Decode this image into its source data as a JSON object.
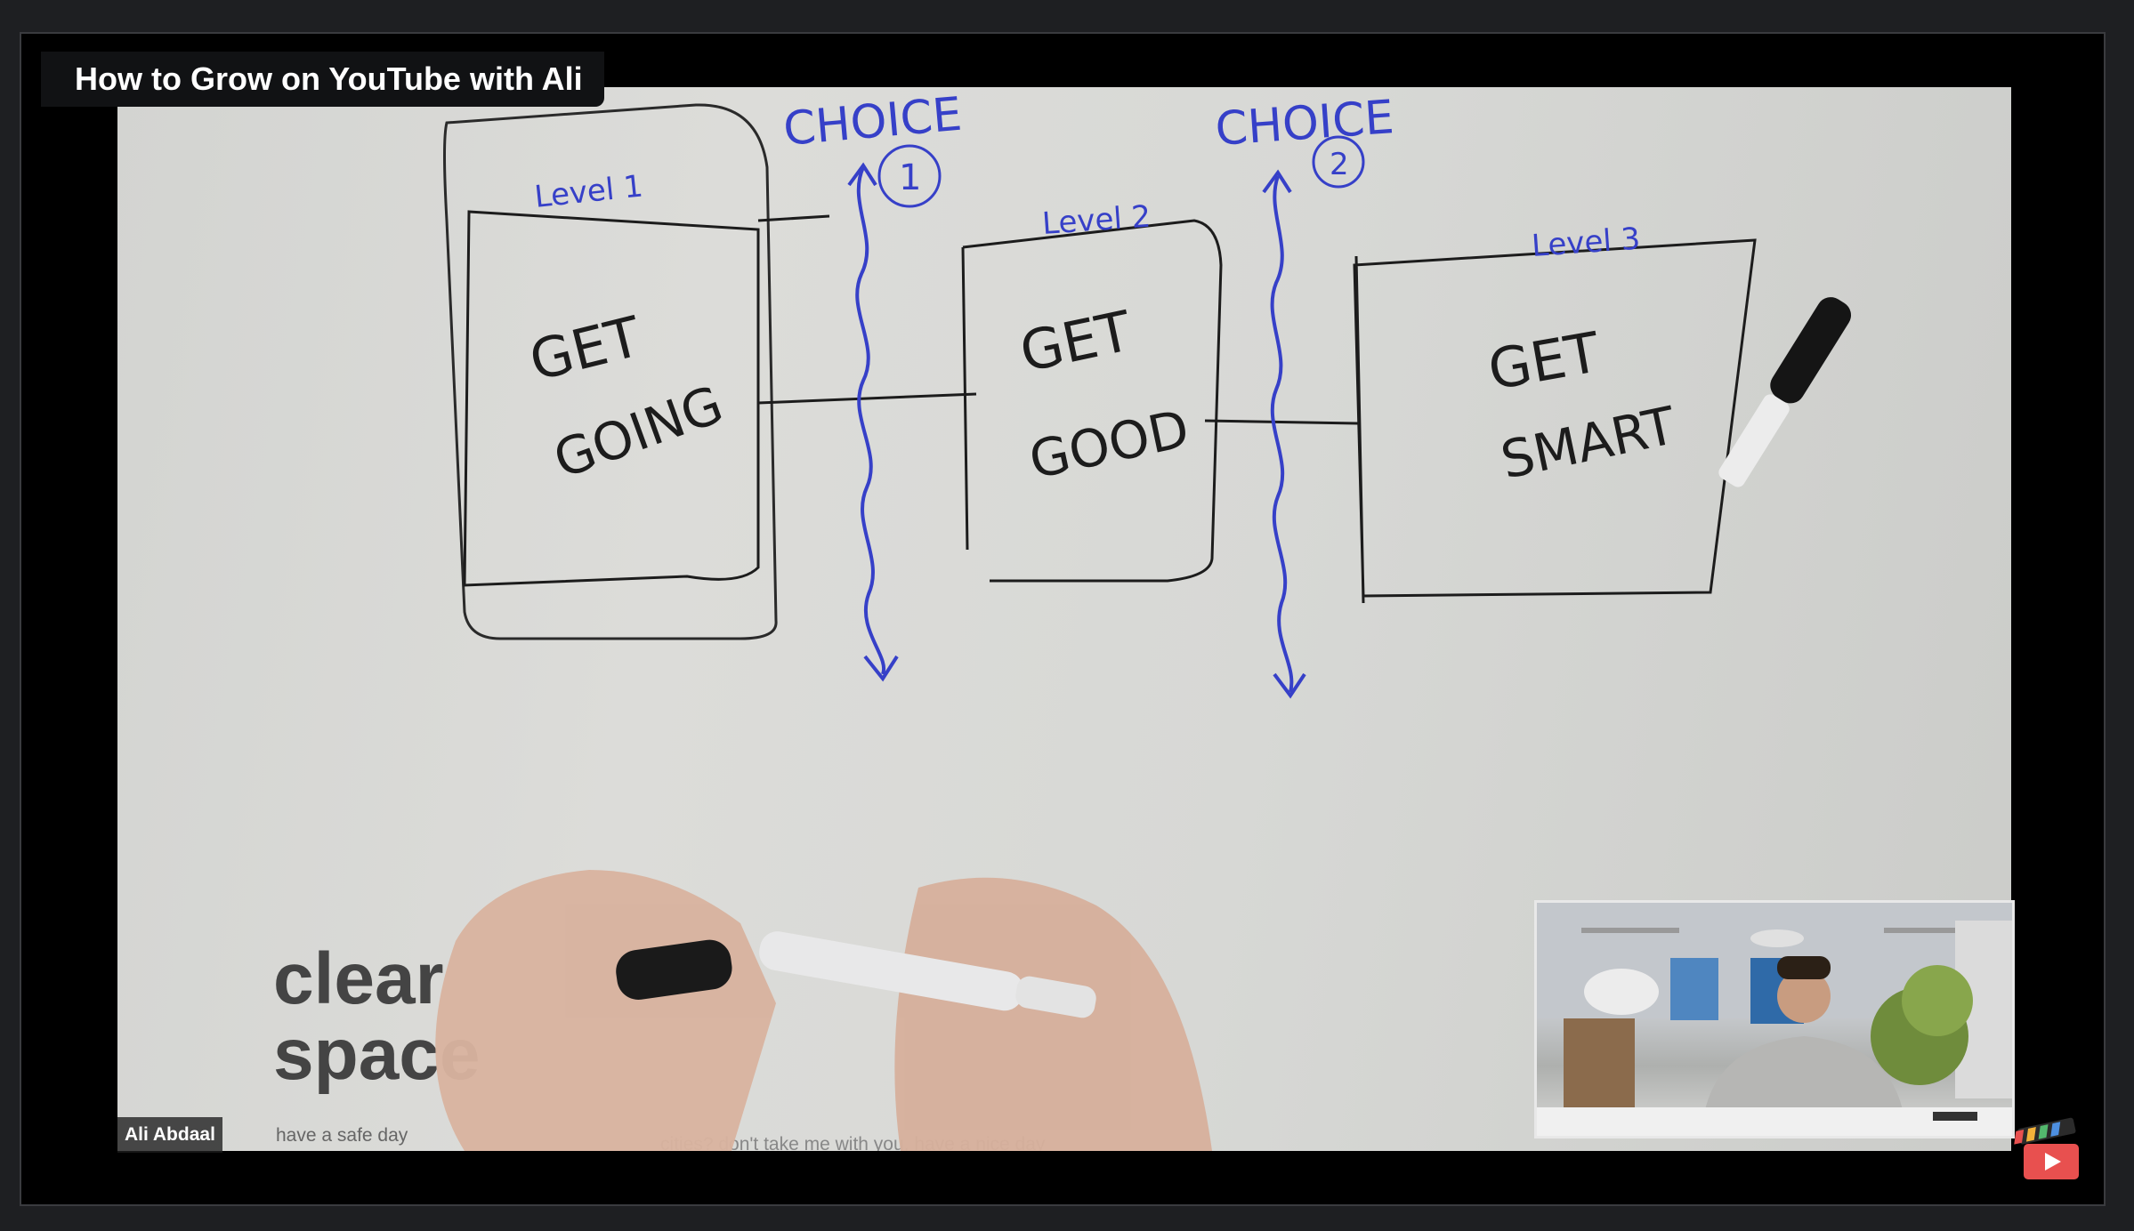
{
  "window": {
    "title": "How to Grow on YouTube with Ali"
  },
  "participant": {
    "name": "Ali Abdaal"
  },
  "whiteboard": {
    "choices": [
      "CHOICE",
      "CHOICE"
    ],
    "choice_numbers": [
      "1",
      "2"
    ],
    "levels": [
      "Level 1",
      "Level 2",
      "Level 3"
    ],
    "boxes": [
      {
        "line1": "GET",
        "line2": "GOING"
      },
      {
        "line1": "GET",
        "line2": "GOOD"
      },
      {
        "line1": "GET",
        "line2": "SMART"
      }
    ],
    "poster_text": [
      "clear",
      "space"
    ],
    "poster_small": "have a safe day",
    "poster_small2": "cities? don't take me with you, have a nice day"
  },
  "colors": {
    "accent_ink": "#3640c8",
    "ink": "#1c1c1c",
    "title_bg": "#111214"
  },
  "icons": {
    "app_logo": "clapperboard-play-icon",
    "marker": "marker-icon"
  }
}
